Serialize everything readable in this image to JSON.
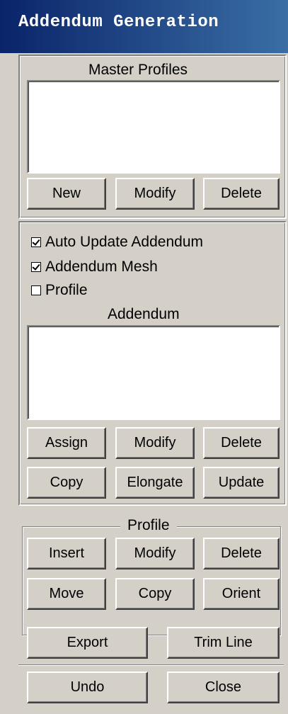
{
  "window": {
    "title": "Addendum Generation"
  },
  "master_profiles": {
    "label": "Master Profiles",
    "buttons": {
      "new": "New",
      "modify": "Modify",
      "delete": "Delete"
    }
  },
  "options": {
    "auto_update": {
      "label": "Auto Update Addendum",
      "checked": true
    },
    "addendum_mesh": {
      "label": "Addendum Mesh",
      "checked": true
    },
    "profile": {
      "label": "Profile",
      "checked": false
    }
  },
  "addendum": {
    "label": "Addendum",
    "buttons": {
      "assign": "Assign",
      "modify": "Modify",
      "delete": "Delete",
      "copy": "Copy",
      "elongate": "Elongate",
      "update": "Update"
    }
  },
  "profile_group": {
    "label": "Profile",
    "buttons": {
      "insert": "Insert",
      "modify": "Modify",
      "delete": "Delete",
      "move": "Move",
      "copy": "Copy",
      "orient": "Orient"
    }
  },
  "bottom": {
    "export": "Export",
    "trim_line": "Trim Line",
    "undo": "Undo",
    "close": "Close"
  }
}
